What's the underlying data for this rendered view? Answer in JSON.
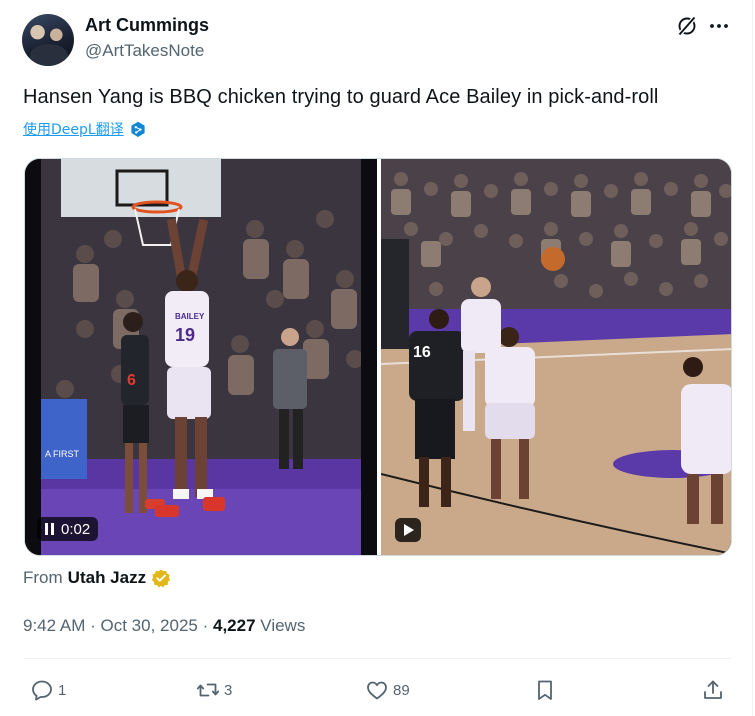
{
  "author": {
    "display_name": "Art Cummings",
    "handle": "@ArtTakesNote"
  },
  "tweet": {
    "text": "Hansen Yang is BBQ chicken trying to guard Ace Bailey in pick-and-roll",
    "translate_label": "使用DeepL翻译"
  },
  "media": {
    "left_video": {
      "duration": "0:02",
      "state_icon": "pause-icon",
      "jersey_number": "19",
      "jersey_name": "BAILEY",
      "opponent_number": "6"
    },
    "right_video": {
      "state_icon": "play-icon",
      "opponent_number": "16"
    }
  },
  "source": {
    "prefix": "From",
    "name": "Utah Jazz",
    "badge": "gold-verified-badge"
  },
  "meta": {
    "time": "9:42 AM",
    "separator": "·",
    "date": "Oct 30, 2025",
    "views_count": "4,227",
    "views_label": "Views"
  },
  "actions": {
    "replies": "1",
    "reposts": "3",
    "likes": "89"
  },
  "colors": {
    "text_primary": "#0f1419",
    "text_secondary": "#536471",
    "link": "#1d9bf0",
    "verified_gold": "#e2b719",
    "court_purple": "#4b2a8c"
  }
}
